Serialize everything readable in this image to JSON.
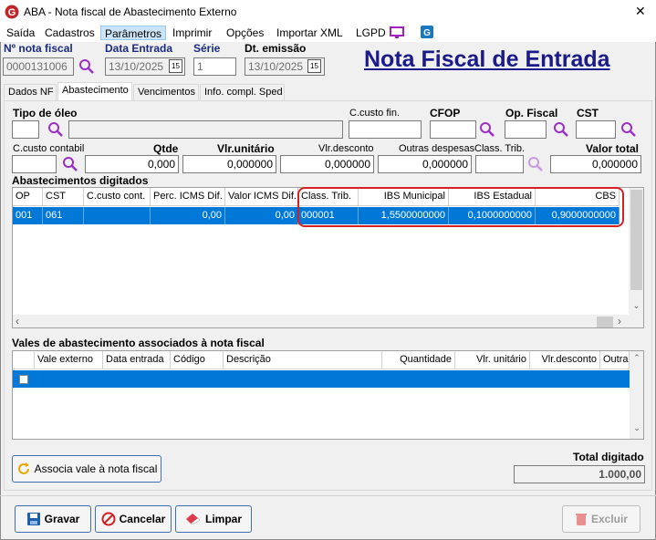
{
  "window": {
    "title": "ABA - Nota fiscal de Abastecimento Externo",
    "close_glyph": "✕"
  },
  "menu": [
    "Saída",
    "Cadastros",
    "Parâmetros",
    "Imprimir",
    "Opções",
    "Importar XML",
    "LGPD"
  ],
  "header": {
    "nota_label": "Nº nota fiscal",
    "nota_value": "0000131006",
    "data_entrada_label": "Data Entrada",
    "data_entrada_value": "13/10/2025",
    "serie_label": "Série",
    "serie_value": "1",
    "dt_emissao_label": "Dt. emissão",
    "dt_emissao_value": "13/10/2025",
    "calendar_glyph": "15",
    "page_title": "Nota Fiscal de Entrada"
  },
  "tabs": [
    "Dados NF",
    "Abastecimento",
    "Vencimentos",
    "Info. compl. Sped"
  ],
  "form": {
    "tipo_oleo_label": "Tipo de óleo",
    "ccusto_fin_label": "C.custo fin.",
    "cfop_label": "CFOP",
    "op_fiscal_label": "Op. Fiscal",
    "cst_label": "CST",
    "ccusto_contabil_label": "C.custo contabil",
    "qtde_label": "Qtde",
    "qtde_value": "0,000",
    "vlr_unitario_label": "Vlr.unitário",
    "vlr_unitario_value": "0,000000",
    "vlr_desconto_label": "Vlr.desconto",
    "vlr_desconto_value": "0,000000",
    "outras_despesas_label": "Outras despesas",
    "outras_despesas_value": "0,000000",
    "class_trib_label": "Class. Trib.",
    "valor_total_label": "Valor total",
    "valor_total_value": "0,000000"
  },
  "abastecimentos": {
    "title": "Abastecimentos digitados",
    "columns": [
      "OP",
      "CST",
      "C.custo cont.",
      "Perc. ICMS Dif.",
      "Valor ICMS Dif.",
      "Class. Trib.",
      "IBS Municipal",
      "IBS Estadual",
      "CBS"
    ],
    "row": {
      "op": "001",
      "cst": "061",
      "ccusto": "",
      "perc_icms": "0,00",
      "valor_icms": "0,00",
      "class_trib": "000001",
      "ibs_municipal": "1,5500000000",
      "ibs_estadual": "0,1000000000",
      "cbs": "0,9000000000"
    },
    "highlight_color": "#d42020",
    "selection_color": "#0078d7"
  },
  "vales": {
    "title": "Vales de abastecimento associados à nota fiscal",
    "columns": [
      "Vale externo",
      "Data entrada",
      "Código",
      "Descrição",
      "Quantidade",
      "Vlr. unitário",
      "Vlr.desconto",
      "Outras"
    ]
  },
  "footer": {
    "associa_button": "Associa vale à nota fiscal",
    "total_label": "Total digitado",
    "total_value": "1.000,00",
    "gravar": "Gravar",
    "cancelar": "Cancelar",
    "limpar": "Limpar",
    "excluir": "Excluir"
  }
}
